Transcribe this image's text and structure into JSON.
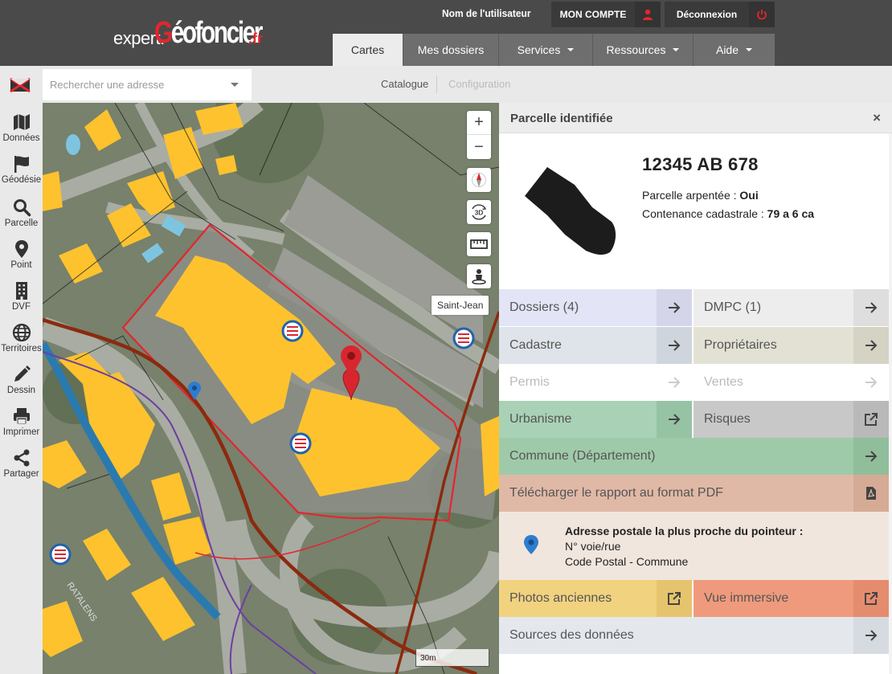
{
  "header": {
    "logo_prefix": "expert.",
    "logo_main_red": "G",
    "logo_main_rest": "éofoncier",
    "logo_suffix": ".fr",
    "username": "Nom de l'utilisateur",
    "account_button": "MON COMPTE",
    "logout_button": "Déconnexion",
    "tabs": [
      {
        "label": "Cartes",
        "active": true
      },
      {
        "label": "Mes dossiers"
      },
      {
        "label": "Services",
        "dropdown": true
      },
      {
        "label": "Ressources",
        "dropdown": true
      },
      {
        "label": "Aide",
        "dropdown": true
      }
    ]
  },
  "toolbar": {
    "search_placeholder": "Rechercher une adresse",
    "catalogue": "Catalogue",
    "configuration": "Configuration"
  },
  "sidebar": {
    "items": [
      {
        "label": "Données",
        "icon": "map-icon"
      },
      {
        "label": "Géodésie",
        "icon": "flag-icon"
      },
      {
        "label": "Parcelle",
        "icon": "search-icon"
      },
      {
        "label": "Point",
        "icon": "pin-icon"
      },
      {
        "label": "DVF",
        "icon": "building-icon"
      },
      {
        "label": "Territoires",
        "icon": "globe-icon"
      },
      {
        "label": "Dessin",
        "icon": "pencil-icon"
      },
      {
        "label": "Imprimer",
        "icon": "printer-icon"
      },
      {
        "label": "Partager",
        "icon": "share-icon"
      }
    ]
  },
  "map": {
    "place_label": "Saint-Jean",
    "street_label": "RATALENS",
    "scale": "30m",
    "controls": {
      "zoom_in": "+",
      "zoom_out": "−",
      "view_3d": "3D"
    }
  },
  "panel": {
    "title": "Parcelle identifiée",
    "close": "×",
    "parcel_id": "12345 AB 678",
    "surveyed_label": "Parcelle arpentée : ",
    "surveyed_value": "Oui",
    "area_label": "Contenance cadastrale : ",
    "area_value": "79 a 6 ca",
    "cells": {
      "dossiers": "Dossiers (4)",
      "dmpc": "DMPC (1)",
      "cadastre": "Cadastre",
      "proprietaires": "Propriétaires",
      "permis": "Permis",
      "ventes": "Ventes",
      "urbanisme": "Urbanisme",
      "risques": "Risques",
      "commune": "Commune (Département)",
      "rapport": "Télécharger le rapport au format PDF",
      "photos": "Photos anciennes",
      "vue": "Vue immersive",
      "sources": "Sources des données"
    },
    "address": {
      "title": "Adresse postale la plus proche du pointeur :",
      "street": "N° voie/rue",
      "city": "Code Postal - Commune"
    }
  },
  "colors": {
    "header_bg": "#4a4a4a",
    "accent_red": "#e3262e",
    "building_yellow": "#fdc22e"
  }
}
